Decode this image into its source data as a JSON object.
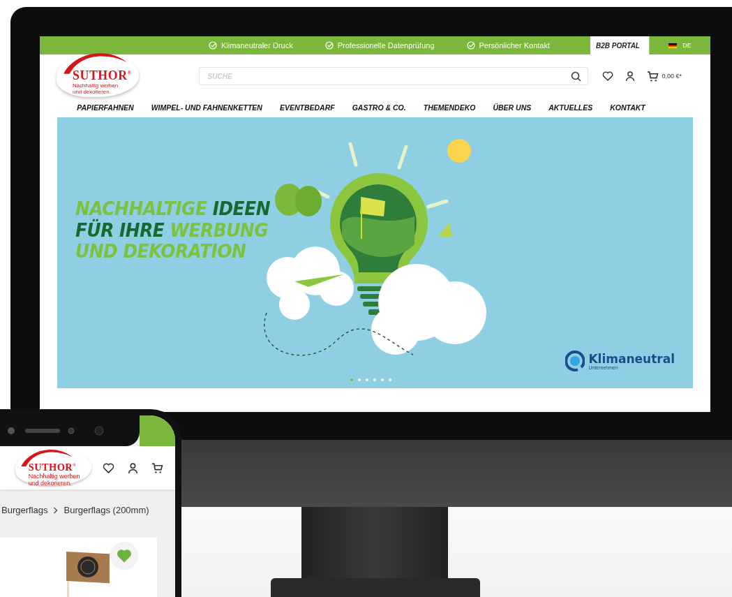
{
  "topbar": {
    "usps": [
      "Klimaneutraler Druck",
      "Professionelle Datenprüfung",
      "Persönlicher Kontakt"
    ],
    "b2b": "B2B PORTAL",
    "language": "DE"
  },
  "header": {
    "logo": {
      "brand": "SUTHOR$^{®}$",
      "tagline": "Nachhaltig werben und dekorieren."
    },
    "search": {
      "placeholder": "SUCHE"
    },
    "cart_total": "0,00 €*"
  },
  "nav": [
    "PAPIERFAHNEN",
    "WIMPEL- UND FAHNENKETTEN",
    "EVENTBEDARF",
    "GASTRO & CO.",
    "THEMENDEKO",
    "ÜBER UNS",
    "AKTUELLES",
    "KONTAKT"
  ],
  "hero": {
    "headline": [
      [
        {
          "text": "NACHHALTIGE",
          "color": "#7cc23e"
        },
        {
          "text": "IDEEN",
          "color": "#156b2f"
        }
      ],
      [
        {
          "text": "FÜR IHRE",
          "color": "#156b2f"
        },
        {
          "text": "WERBUNG",
          "color": "#7cc23e"
        }
      ],
      [
        {
          "text": "UND DEKORATION",
          "color": "#7cc23e"
        }
      ]
    ],
    "badge": {
      "title": "Klimaneutral",
      "subtitle": "Unternehmen"
    },
    "slides": [
      {
        "selected": true
      },
      {
        "selected": false
      },
      {
        "selected": false
      },
      {
        "selected": false
      },
      {
        "selected": false
      },
      {
        "selected": false
      }
    ]
  },
  "phone": {
    "logo": {
      "brand": "SUTHOR$^{®}$",
      "tagline": "Nachhaltig werben und dekorieren."
    },
    "breadcrumb": [
      "Burgerflags",
      "Burgerflags (200mm)"
    ],
    "product": {
      "favorite": true
    }
  }
}
